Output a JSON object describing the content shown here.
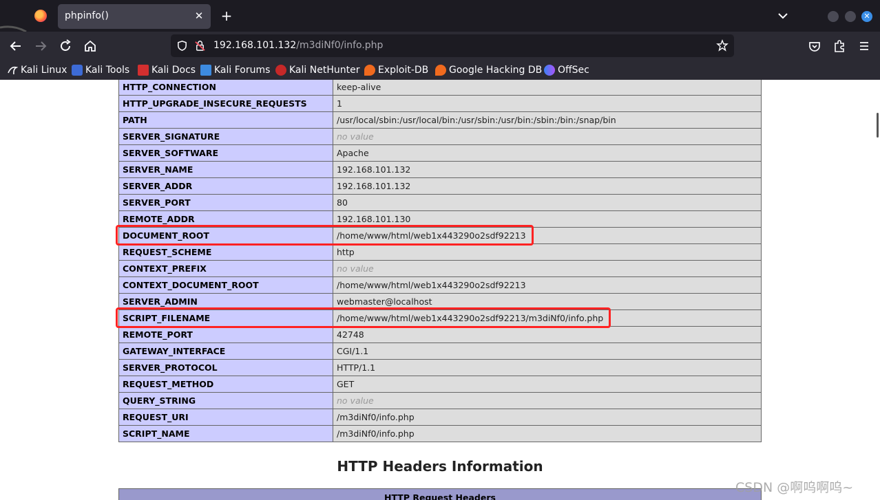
{
  "browser": {
    "tab_title": "phpinfo()",
    "url_host": "192.168.101.132",
    "url_path": "/m3diNf0/info.php",
    "accent": "#3a8ee6"
  },
  "bookmarks": [
    {
      "label": "Kali Linux",
      "icon": "kali-dragon-icon"
    },
    {
      "label": "Kali Tools",
      "icon": "kali-tools-icon"
    },
    {
      "label": "Kali Docs",
      "icon": "kali-docs-icon"
    },
    {
      "label": "Kali Forums",
      "icon": "kali-forums-icon"
    },
    {
      "label": "Kali NetHunter",
      "icon": "nethunter-icon"
    },
    {
      "label": "Exploit-DB",
      "icon": "exploit-db-icon"
    },
    {
      "label": "Google Hacking DB",
      "icon": "ghdb-icon"
    },
    {
      "label": "OffSec",
      "icon": "offsec-icon"
    }
  ],
  "env_rows": [
    {
      "key": "HTTP_CONNECTION",
      "value": "keep-alive"
    },
    {
      "key": "HTTP_UPGRADE_INSECURE_REQUESTS",
      "value": "1"
    },
    {
      "key": "PATH",
      "value": "/usr/local/sbin:/usr/local/bin:/usr/sbin:/usr/bin:/sbin:/bin:/snap/bin"
    },
    {
      "key": "SERVER_SIGNATURE",
      "value": "no value",
      "novalue": true
    },
    {
      "key": "SERVER_SOFTWARE",
      "value": "Apache"
    },
    {
      "key": "SERVER_NAME",
      "value": "192.168.101.132"
    },
    {
      "key": "SERVER_ADDR",
      "value": "192.168.101.132"
    },
    {
      "key": "SERVER_PORT",
      "value": "80"
    },
    {
      "key": "REMOTE_ADDR",
      "value": "192.168.101.130"
    },
    {
      "key": "DOCUMENT_ROOT",
      "value": "/home/www/html/web1x443290o2sdf92213",
      "highlight": true
    },
    {
      "key": "REQUEST_SCHEME",
      "value": "http"
    },
    {
      "key": "CONTEXT_PREFIX",
      "value": "no value",
      "novalue": true
    },
    {
      "key": "CONTEXT_DOCUMENT_ROOT",
      "value": "/home/www/html/web1x443290o2sdf92213"
    },
    {
      "key": "SERVER_ADMIN",
      "value": "webmaster@localhost"
    },
    {
      "key": "SCRIPT_FILENAME",
      "value": "/home/www/html/web1x443290o2sdf92213/m3diNf0/info.php",
      "highlight": true
    },
    {
      "key": "REMOTE_PORT",
      "value": "42748"
    },
    {
      "key": "GATEWAY_INTERFACE",
      "value": "CGI/1.1"
    },
    {
      "key": "SERVER_PROTOCOL",
      "value": "HTTP/1.1"
    },
    {
      "key": "REQUEST_METHOD",
      "value": "GET"
    },
    {
      "key": "QUERY_STRING",
      "value": "no value",
      "novalue": true
    },
    {
      "key": "REQUEST_URI",
      "value": "/m3diNf0/info.php"
    },
    {
      "key": "SCRIPT_NAME",
      "value": "/m3diNf0/info.php"
    }
  ],
  "section_heading": "HTTP Headers Information",
  "headers_table_title": "HTTP Request Headers",
  "watermark": "CSDN @啊呜啊呜~",
  "highlight_color": "#ff2222"
}
